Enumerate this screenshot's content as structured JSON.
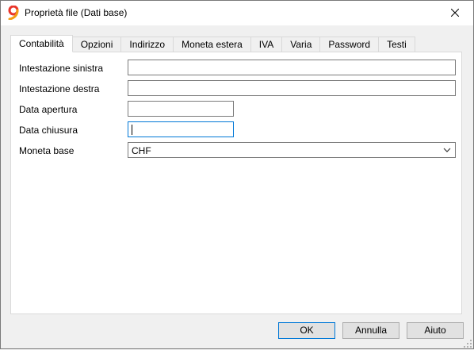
{
  "window": {
    "title": "Proprietà file (Dati base)",
    "app_icon": "banana-9-icon",
    "close_icon": "close-icon"
  },
  "tabs": [
    {
      "label": "Contabilità",
      "active": true
    },
    {
      "label": "Opzioni",
      "active": false
    },
    {
      "label": "Indirizzo",
      "active": false
    },
    {
      "label": "Moneta estera",
      "active": false
    },
    {
      "label": "IVA",
      "active": false
    },
    {
      "label": "Varia",
      "active": false
    },
    {
      "label": "Password",
      "active": false
    },
    {
      "label": "Testi",
      "active": false
    }
  ],
  "form": {
    "intestazione_sinistra": {
      "label": "Intestazione sinistra",
      "value": ""
    },
    "intestazione_destra": {
      "label": "Intestazione destra",
      "value": ""
    },
    "data_apertura": {
      "label": "Data apertura",
      "value": ""
    },
    "data_chiusura": {
      "label": "Data chiusura",
      "value": ""
    },
    "moneta_base": {
      "label": "Moneta base",
      "value": "CHF"
    }
  },
  "buttons": {
    "ok": "OK",
    "annulla": "Annulla",
    "aiuto": "Aiuto"
  },
  "colors": {
    "focus": "#0078d7",
    "app_icon_red": "#e8352b",
    "app_icon_orange": "#f39c12"
  }
}
